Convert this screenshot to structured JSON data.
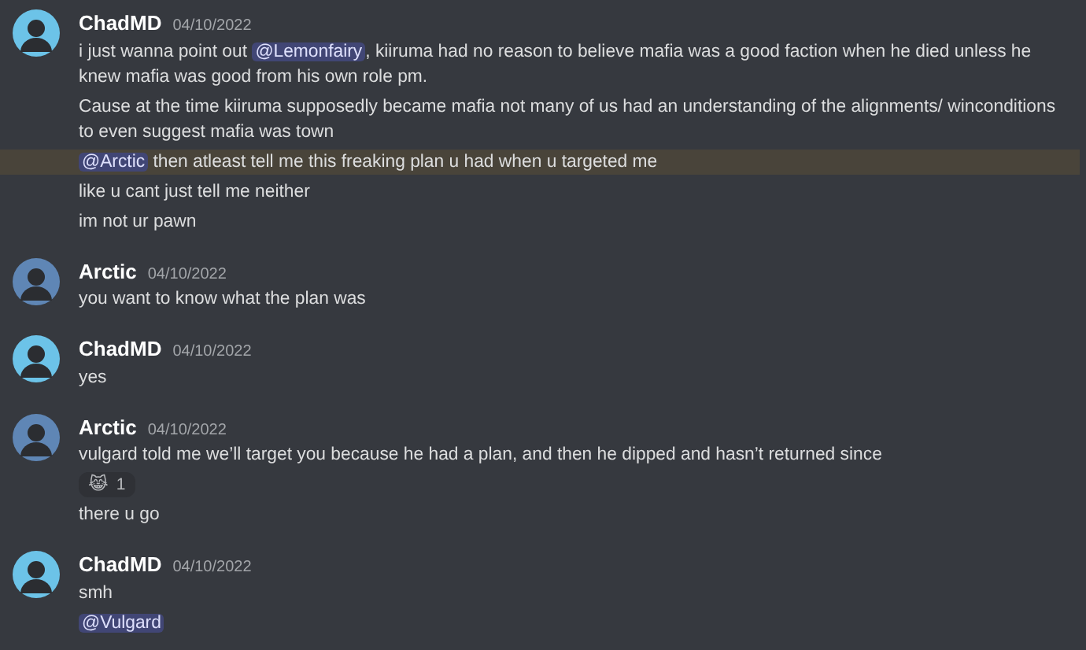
{
  "messages": [
    {
      "author": "ChadMD",
      "color": "#6cc3e8",
      "timestamp": "04/10/2022",
      "lines": [
        {
          "highlighted": false,
          "parts": [
            {
              "kind": "text",
              "text": "i just wanna point out "
            },
            {
              "kind": "mention",
              "text": "@Lemonfairy"
            },
            {
              "kind": "text",
              "text": ", kiiruma had no reason to believe mafia was a good faction when he died unless he knew mafia was good from his own role pm."
            }
          ]
        },
        {
          "highlighted": false,
          "parts": [
            {
              "kind": "text",
              "text": "Cause at the time kiiruma supposedly became mafia not many of us had an understanding of the alignments/ winconditions to even suggest mafia was town"
            }
          ]
        },
        {
          "highlighted": true,
          "parts": [
            {
              "kind": "mention",
              "text": "@Arctic"
            },
            {
              "kind": "text",
              "text": " then atleast tell me this freaking plan u had when u targeted me"
            }
          ]
        },
        {
          "highlighted": false,
          "parts": [
            {
              "kind": "text",
              "text": "like u cant just tell me neither"
            }
          ]
        },
        {
          "highlighted": false,
          "parts": [
            {
              "kind": "text",
              "text": "im not ur pawn"
            }
          ]
        }
      ]
    },
    {
      "author": "Arctic",
      "color": "#5f86b5",
      "timestamp": "04/10/2022",
      "lines": [
        {
          "highlighted": false,
          "parts": [
            {
              "kind": "text",
              "text": "you want to know what the plan was"
            }
          ]
        }
      ]
    },
    {
      "author": "ChadMD",
      "color": "#6cc3e8",
      "timestamp": "04/10/2022",
      "lines": [
        {
          "highlighted": false,
          "parts": [
            {
              "kind": "text",
              "text": "yes"
            }
          ]
        }
      ]
    },
    {
      "author": "Arctic",
      "color": "#5f86b5",
      "timestamp": "04/10/2022",
      "lines": [
        {
          "highlighted": false,
          "parts": [
            {
              "kind": "text",
              "text": "vulgard told me we’ll target you because he had a plan, and then he dipped and hasn’t returned since"
            }
          ],
          "reaction": {
            "emoji": "😹",
            "count": "1"
          }
        },
        {
          "highlighted": false,
          "parts": [
            {
              "kind": "text",
              "text": "there u go"
            }
          ]
        }
      ]
    },
    {
      "author": "ChadMD",
      "color": "#6cc3e8",
      "timestamp": "04/10/2022",
      "lines": [
        {
          "highlighted": false,
          "parts": [
            {
              "kind": "text",
              "text": "smh"
            }
          ]
        },
        {
          "highlighted": false,
          "parts": [
            {
              "kind": "mention",
              "text": "@Vulgard"
            }
          ]
        }
      ]
    }
  ]
}
